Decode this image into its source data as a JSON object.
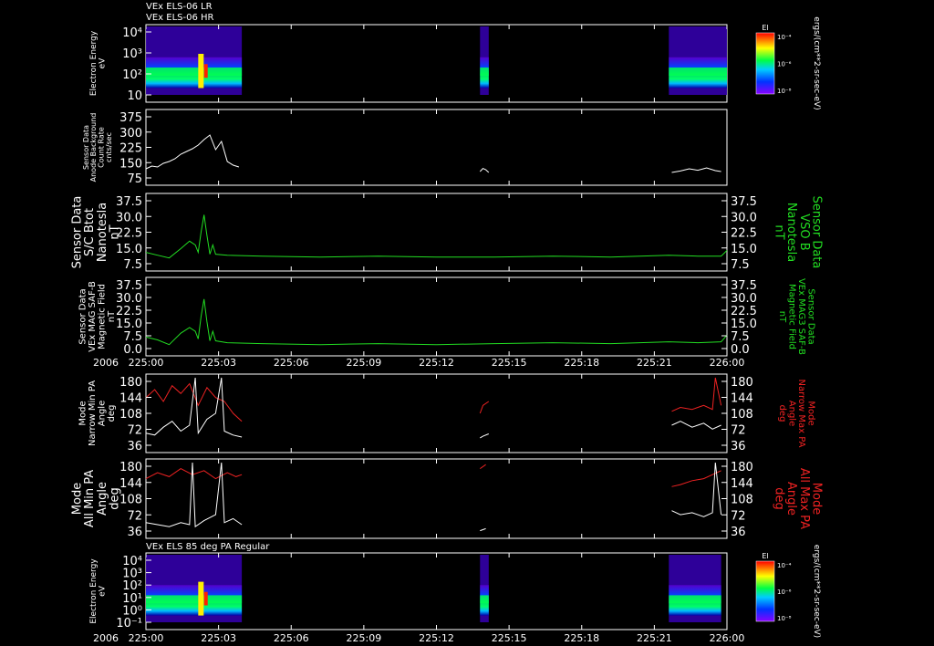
{
  "header": {
    "line1": "VEx ELS-06 LR",
    "line2": "VEx ELS-06 HR"
  },
  "colors": {
    "white": "#ffffff",
    "green": "#22dd22",
    "red": "#ee2222",
    "axis": "#ffffff"
  },
  "colorbar": {
    "title": "El",
    "units": "ergs/(cm**2-sr-sec-eV)",
    "ticks": [
      "10⁻⁴",
      "10⁻⁶",
      "10⁻⁸"
    ]
  },
  "time_axis": {
    "year": "2006",
    "ticks": [
      "225:00",
      "225:03",
      "225:06",
      "225:09",
      "225:12",
      "225:15",
      "225:18",
      "225:21",
      "226:00"
    ]
  },
  "chart_data": [
    {
      "type": "heatmap",
      "id": "els-lr",
      "ylabel": [
        "Electron Energy",
        "eV"
      ],
      "yticks": [
        "10⁴",
        "10³",
        "10²",
        "10"
      ],
      "y_scale": "log",
      "coverage": [
        [
          0.0,
          0.165
        ],
        [
          0.575,
          0.59
        ],
        [
          0.9,
          1.0
        ]
      ]
    },
    {
      "type": "line",
      "id": "count-rate",
      "ylabel": [
        "Sensor Data",
        "Anode Background",
        "Count Rate",
        "cnts/sec"
      ],
      "yticks": [
        "375",
        "300",
        "225",
        "150",
        "75"
      ],
      "ylim": [
        0,
        375
      ],
      "color": "#ffffff",
      "segments": [
        {
          "x": [
            0.0,
            0.01,
            0.02,
            0.03,
            0.04,
            0.05,
            0.06,
            0.07,
            0.08,
            0.09,
            0.1,
            0.11,
            0.12,
            0.13,
            0.14,
            0.15,
            0.16
          ],
          "y": [
            70,
            85,
            80,
            100,
            110,
            125,
            150,
            165,
            180,
            200,
            230,
            255,
            175,
            220,
            110,
            90,
            80
          ]
        },
        {
          "x": [
            0.575,
            0.58,
            0.585,
            0.59
          ],
          "y": [
            55,
            72,
            65,
            50
          ]
        },
        {
          "x": [
            0.905,
            0.92,
            0.935,
            0.95,
            0.965,
            0.98,
            0.99
          ],
          "y": [
            50,
            58,
            70,
            62,
            75,
            60,
            55
          ]
        }
      ]
    },
    {
      "type": "line",
      "id": "btot",
      "ylabel": [
        "Sensor Data",
        "S/C Btot",
        "Nanotesla",
        "nT"
      ],
      "right_label": [
        "Sensor Data",
        "VSO B",
        "Nanotesla",
        "nT"
      ],
      "yticks": [
        "37.5",
        "30.0",
        "22.5",
        "15.0",
        "7.5"
      ],
      "ylim": [
        0,
        37.5
      ],
      "color": "#22dd22",
      "segments": [
        {
          "x": [
            0.0,
            0.02,
            0.04,
            0.06,
            0.075,
            0.085,
            0.09,
            0.095,
            0.1,
            0.105,
            0.11,
            0.115,
            0.12,
            0.14,
            0.2,
            0.3,
            0.4,
            0.5,
            0.6,
            0.7,
            0.8,
            0.9,
            0.95,
            0.99,
            1.0
          ],
          "y": [
            8,
            6.5,
            5,
            10,
            14,
            12,
            8,
            19,
            28,
            17,
            7,
            12,
            7,
            6.5,
            6,
            5.5,
            6,
            5.5,
            5.5,
            6,
            5.5,
            6.5,
            6,
            6,
            9
          ]
        }
      ]
    },
    {
      "type": "line",
      "id": "mag-field",
      "ylabel": [
        "Sensor Data",
        "VEx MAG SAF-B",
        "Magnetic Field",
        "nT"
      ],
      "right_label": [
        "Sensor Data",
        "VEx MAG3 SAF-B",
        "Magnetic Field",
        "nT"
      ],
      "yticks": [
        "37.5",
        "30.0",
        "22.5",
        "15.0",
        "7.5",
        "0.0"
      ],
      "ylim": [
        0,
        37.5
      ],
      "color": "#22dd22",
      "segments": [
        {
          "x": [
            0.0,
            0.02,
            0.04,
            0.06,
            0.075,
            0.085,
            0.09,
            0.095,
            0.1,
            0.105,
            0.11,
            0.115,
            0.12,
            0.14,
            0.2,
            0.3,
            0.4,
            0.5,
            0.6,
            0.7,
            0.8,
            0.9,
            0.95,
            0.99,
            1.0
          ],
          "y": [
            8,
            6.5,
            4,
            10,
            13,
            11,
            7,
            19,
            28,
            16,
            6,
            11,
            6,
            5,
            4.5,
            4,
            4.5,
            4,
            4.5,
            5,
            4.5,
            5.5,
            5,
            5.5,
            9
          ]
        }
      ]
    },
    {
      "type": "line",
      "id": "narrow-pa",
      "ylabel": [
        "Mode",
        "Narrow Min PA",
        "Angle",
        "deg"
      ],
      "right_label": [
        "Mode",
        "Narrow Max PA",
        "Angle",
        "deg"
      ],
      "yticks": [
        "180",
        "144",
        "108",
        "72",
        "36"
      ],
      "ylim": [
        0,
        180
      ],
      "series": [
        {
          "color": "#ee2222",
          "segments": [
            {
              "x": [
                0.0,
                0.015,
                0.03,
                0.045,
                0.06,
                0.075,
                0.09,
                0.105,
                0.12,
                0.135,
                0.15,
                0.165
              ],
              "y": [
                130,
                150,
                120,
                160,
                140,
                165,
                110,
                155,
                130,
                120,
                90,
                70
              ]
            },
            {
              "x": [
                0.575,
                0.58,
                0.59
              ],
              "y": [
                90,
                110,
                120
              ]
            },
            {
              "x": [
                0.905,
                0.92,
                0.94,
                0.96,
                0.975,
                0.98,
                0.99
              ],
              "y": [
                95,
                105,
                100,
                110,
                100,
                180,
                110
              ]
            }
          ]
        },
        {
          "color": "#ffffff",
          "segments": [
            {
              "x": [
                0.0,
                0.015,
                0.03,
                0.045,
                0.06,
                0.075,
                0.085,
                0.09,
                0.105,
                0.12,
                0.13,
                0.135,
                0.15,
                0.165
              ],
              "y": [
                40,
                35,
                55,
                70,
                45,
                60,
                180,
                40,
                75,
                90,
                180,
                45,
                35,
                30
              ]
            },
            {
              "x": [
                0.575,
                0.58,
                0.59
              ],
              "y": [
                28,
                32,
                38
              ]
            },
            {
              "x": [
                0.905,
                0.92,
                0.94,
                0.96,
                0.975,
                0.99
              ],
              "y": [
                60,
                70,
                55,
                65,
                50,
                60
              ]
            }
          ]
        }
      ]
    },
    {
      "type": "line",
      "id": "all-pa",
      "ylabel": [
        "Mode",
        "All Min PA",
        "Angle",
        "deg"
      ],
      "right_label": [
        "Mode",
        "All Max PA",
        "Angle",
        "deg"
      ],
      "yticks": [
        "180",
        "144",
        "108",
        "72",
        "36"
      ],
      "ylim": [
        0,
        180
      ],
      "series": [
        {
          "color": "#ee2222",
          "segments": [
            {
              "x": [
                0.0,
                0.02,
                0.04,
                0.06,
                0.08,
                0.1,
                0.12,
                0.14,
                0.155,
                0.165
              ],
              "y": [
                140,
                155,
                145,
                165,
                150,
                160,
                140,
                155,
                145,
                150
              ]
            },
            {
              "x": [
                0.575,
                0.585
              ],
              "y": [
                165,
                175
              ]
            },
            {
              "x": [
                0.905,
                0.92,
                0.94,
                0.96,
                0.975,
                0.99
              ],
              "y": [
                120,
                125,
                135,
                140,
                150,
                160
              ]
            }
          ]
        },
        {
          "color": "#ffffff",
          "segments": [
            {
              "x": [
                0.0,
                0.02,
                0.04,
                0.06,
                0.075,
                0.08,
                0.085,
                0.1,
                0.12,
                0.13,
                0.135,
                0.15,
                0.165
              ],
              "y": [
                30,
                25,
                20,
                30,
                25,
                180,
                20,
                35,
                50,
                180,
                30,
                40,
                25
              ]
            },
            {
              "x": [
                0.575,
                0.585
              ],
              "y": [
                10,
                15
              ]
            },
            {
              "x": [
                0.905,
                0.92,
                0.94,
                0.96,
                0.975,
                0.98,
                0.99
              ],
              "y": [
                60,
                50,
                55,
                45,
                55,
                180,
                50
              ]
            }
          ]
        }
      ]
    },
    {
      "type": "heatmap",
      "id": "els-85",
      "title": "VEx ELS 85 deg PA Regular",
      "ylabel": [
        "Electron Energy",
        "eV"
      ],
      "yticks": [
        "10⁴",
        "10³",
        "10²",
        "10¹",
        "10⁰",
        "10⁻¹"
      ],
      "y_scale": "log",
      "coverage": [
        [
          0.0,
          0.165
        ],
        [
          0.575,
          0.59
        ],
        [
          0.9,
          0.99
        ]
      ]
    }
  ]
}
